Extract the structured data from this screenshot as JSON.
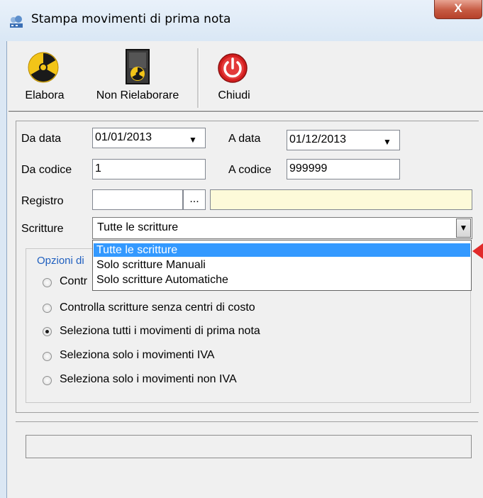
{
  "window": {
    "title": "Stampa movimenti di prima nota",
    "close_glyph": "X"
  },
  "toolbar": {
    "items": [
      {
        "label": "Elabora",
        "icon": "radiation-icon"
      },
      {
        "label": "Non Rielaborare",
        "icon": "radiation-box-icon"
      },
      {
        "label": "Chiudi",
        "icon": "power-icon"
      }
    ]
  },
  "form": {
    "da_data_label": "Da data",
    "da_data_value": "01/01/2013",
    "a_data_label": "A data",
    "a_data_value": "01/12/2013",
    "da_codice_label": "Da codice",
    "da_codice_value": "1",
    "a_codice_label": "A codice",
    "a_codice_value": "999999",
    "registro_label": "Registro",
    "registro_value": "",
    "registro_browse": "...",
    "registro_desc": "",
    "scritture_label": "Scritture",
    "scritture_value": "Tutte le scritture"
  },
  "dropdown": {
    "options": [
      "Tutte le scritture",
      "Solo scritture Manuali",
      "Solo scritture Automatiche"
    ],
    "selected_index": 0
  },
  "group": {
    "title": "Opzioni di",
    "options": [
      {
        "label": "Contr",
        "checked": false
      },
      {
        "label": "Controlla scritture senza centri di costo",
        "checked": false
      },
      {
        "label": "Seleziona tutti i movimenti di prima nota",
        "checked": true
      },
      {
        "label": "Seleziona solo i movimenti IVA",
        "checked": false
      },
      {
        "label": "Seleziona solo i movimenti non IVA",
        "checked": false
      }
    ]
  },
  "colors": {
    "highlight": "#3399ff",
    "registro_desc_bg": "#fdfad9",
    "group_title": "#1f5fbf",
    "pointer": "#e12a2a"
  }
}
